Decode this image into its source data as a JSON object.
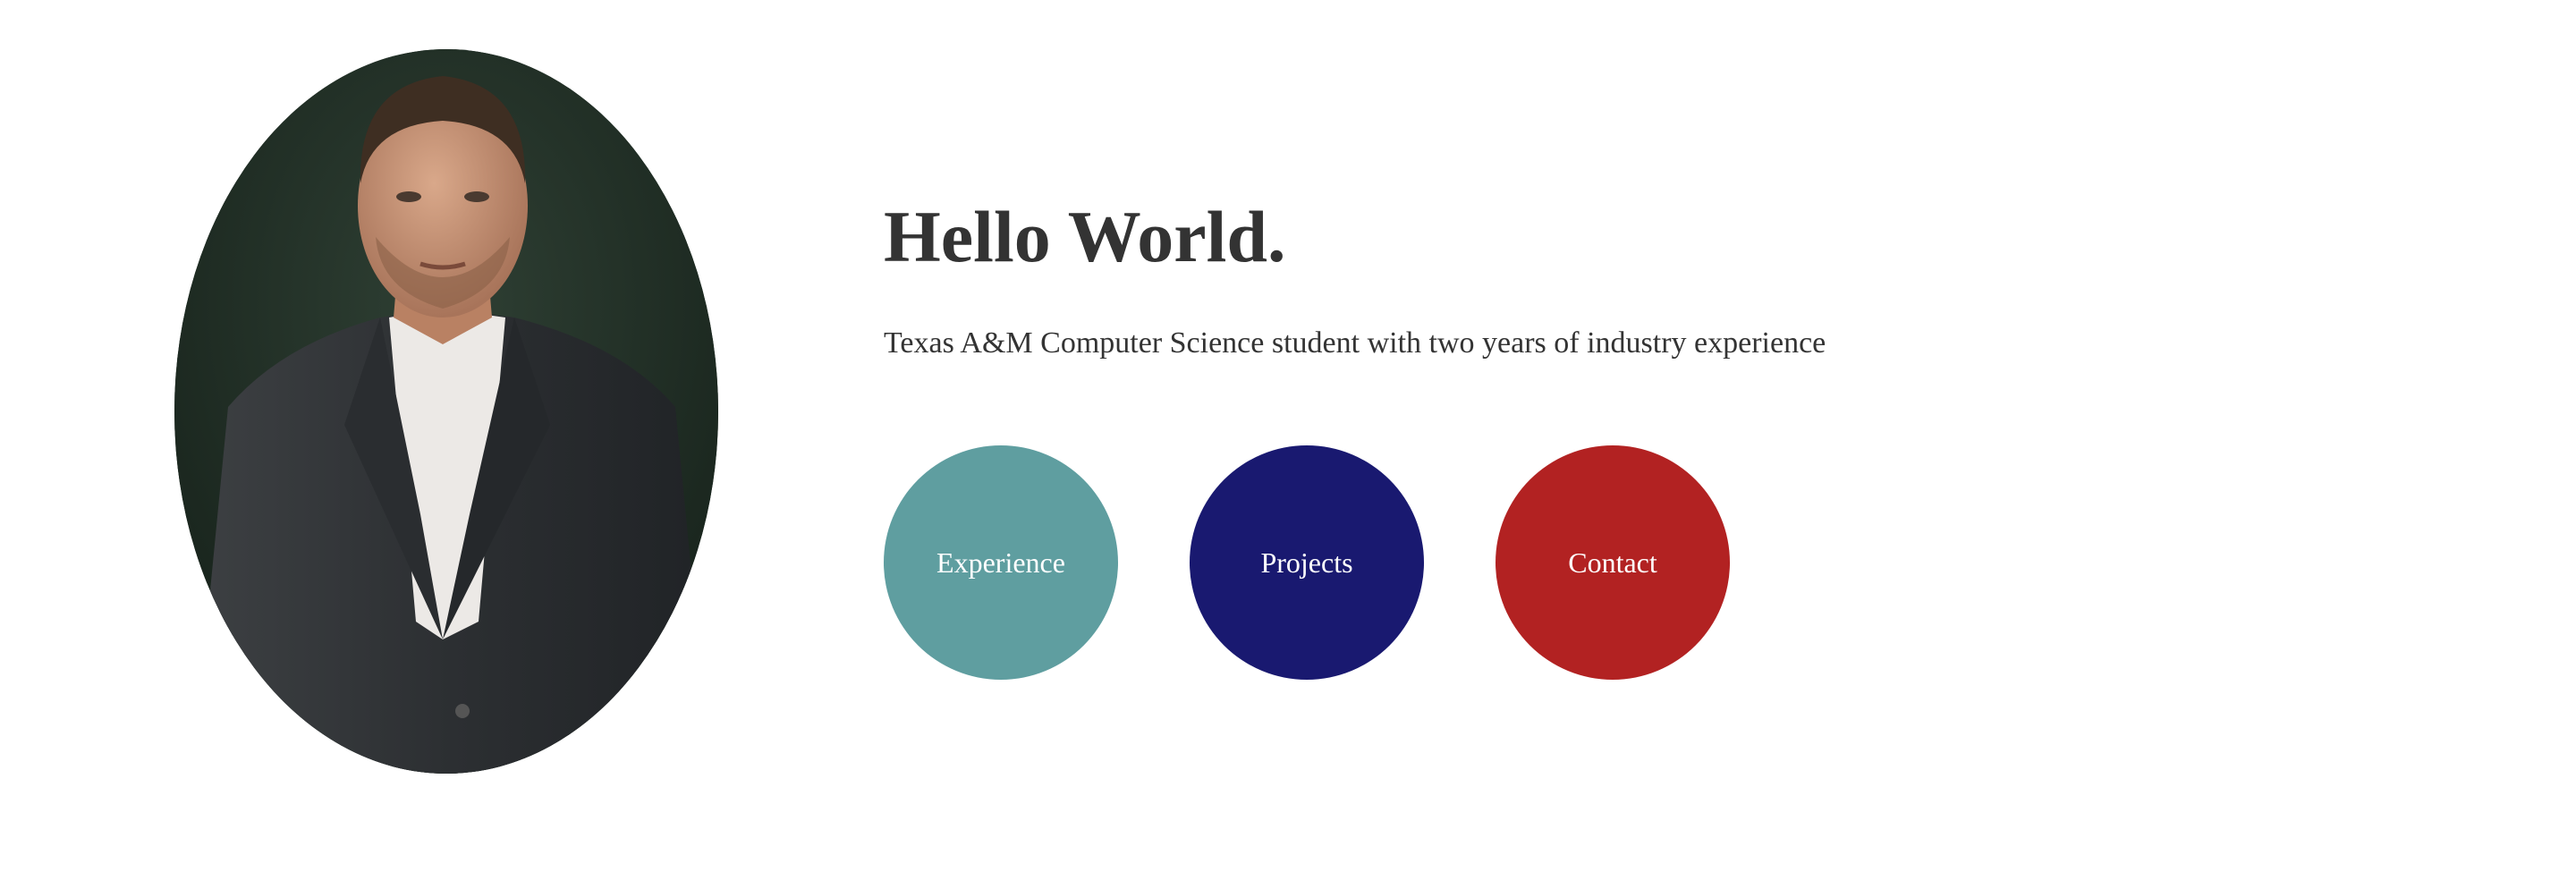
{
  "profile": {
    "photo_icon": "portrait-photo"
  },
  "hero": {
    "title": "Hello World.",
    "subtitle": "Texas A&M Computer Science student with two years of industry experience"
  },
  "nav": {
    "experience": {
      "label": "Experience",
      "color": "#5f9ea0"
    },
    "projects": {
      "label": "Projects",
      "color": "#191970"
    },
    "contact": {
      "label": "Contact",
      "color": "#b22222"
    }
  }
}
